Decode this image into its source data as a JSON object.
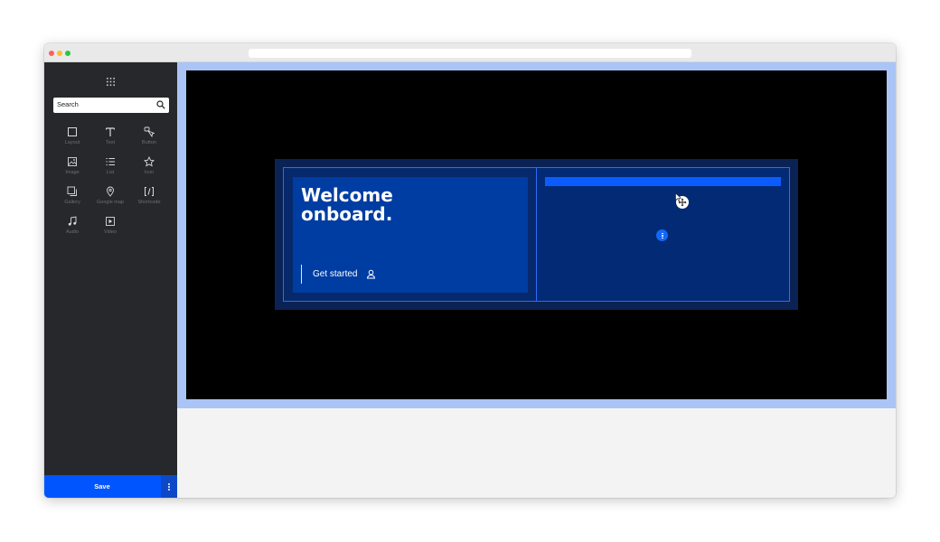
{
  "sidebar": {
    "search": {
      "placeholder": "Search"
    },
    "widgets": [
      {
        "label": "Layout",
        "icon": "layout-icon"
      },
      {
        "label": "Text",
        "icon": "text-icon"
      },
      {
        "label": "Button",
        "icon": "button-icon"
      },
      {
        "label": "Image",
        "icon": "image-icon"
      },
      {
        "label": "List",
        "icon": "list-icon"
      },
      {
        "label": "Icon",
        "icon": "star-icon"
      },
      {
        "label": "Gallery",
        "icon": "gallery-icon"
      },
      {
        "label": "Google map",
        "icon": "map-pin-icon"
      },
      {
        "label": "Shortcode",
        "icon": "shortcode-icon"
      },
      {
        "label": "Audio",
        "icon": "music-note-icon"
      },
      {
        "label": "Video",
        "icon": "video-icon"
      }
    ],
    "save_label": "Save"
  },
  "canvas": {
    "headline_line1": "Welcome",
    "headline_line2": "onboard.",
    "cta_label": "Get started",
    "colors": {
      "accent": "#0055ff",
      "section_outline": "#aac4f6",
      "card": "#003da2",
      "column_border": "#2a6df5"
    }
  }
}
